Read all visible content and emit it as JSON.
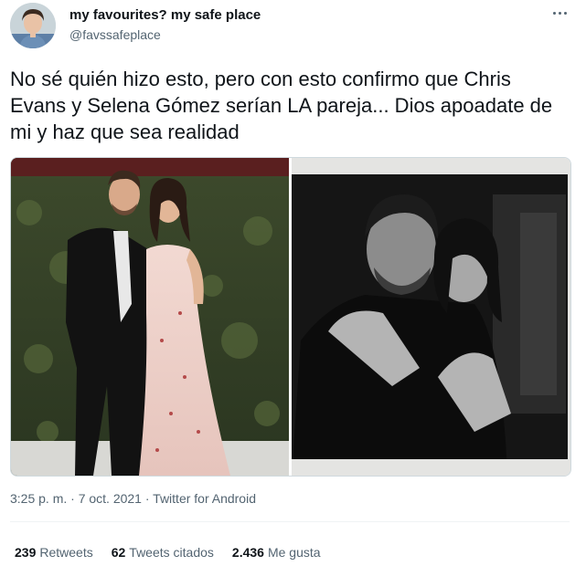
{
  "author": {
    "display_name": "my favourites? my safe place",
    "handle": "@favssafeplace",
    "avatar_icon": "user-avatar"
  },
  "tweet": {
    "text": "No sé quién hizo esto, pero con esto confirmo que Chris Evans y Selena Gómez serían LA pareja... Dios apoadate de mi y haz que sea realidad",
    "timestamp": "3:25 p. m. · 7 oct. 2021 · Twitter for Android"
  },
  "media": {
    "left_photo_icon": "couple-photo-color",
    "right_photo_icon": "couple-photo-bw"
  },
  "stats": {
    "retweets_count": "239",
    "retweets_label": "Retweets",
    "quotes_count": "62",
    "quotes_label": "Tweets citados",
    "likes_count": "2.436",
    "likes_label": "Me gusta"
  },
  "colors": {
    "text_primary": "#0f1419",
    "text_secondary": "#536471",
    "divider": "#eff3f4"
  }
}
